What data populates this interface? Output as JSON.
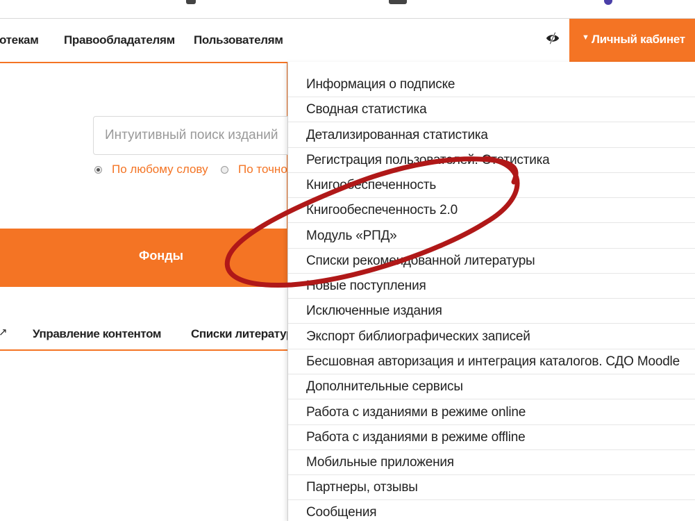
{
  "nav": {
    "links": [
      "отекам",
      "Правообладателям",
      "Пользователям"
    ],
    "cabinet_label": "Личный кабинет",
    "eye_icon": "eye-slash-icon",
    "accent_color": "#f47424"
  },
  "search": {
    "placeholder": "Интуитивный поиск изданий",
    "options": [
      "По любому слову",
      "По точно"
    ],
    "selected_option": "По любому слову"
  },
  "band": {
    "fondy_label": "Фонды"
  },
  "subnav": {
    "links": [
      "Управление контентом",
      "Списки литератур"
    ]
  },
  "dropdown": {
    "items": [
      "Информация о подписке",
      "Сводная статистика",
      "Детализированная статистика",
      "Регистрация пользователей. Статистика",
      "Книгообеспеченность",
      "Книгообеспеченность 2.0",
      "Модуль «РПД»",
      "Списки рекомендованной литературы",
      "Новые поступления",
      "Исключенные издания",
      "Экспорт библиографических записей",
      "Бесшовная авторизация и интеграция каталогов. СДО Moodle",
      "Дополнительные сервисы",
      "Работа с изданиями в режиме online",
      "Работа с изданиями в режиме offline",
      "Мобильные приложения",
      "Партнеры, отзывы",
      "Сообщения"
    ]
  },
  "annotation": {
    "color": "#b01818"
  }
}
